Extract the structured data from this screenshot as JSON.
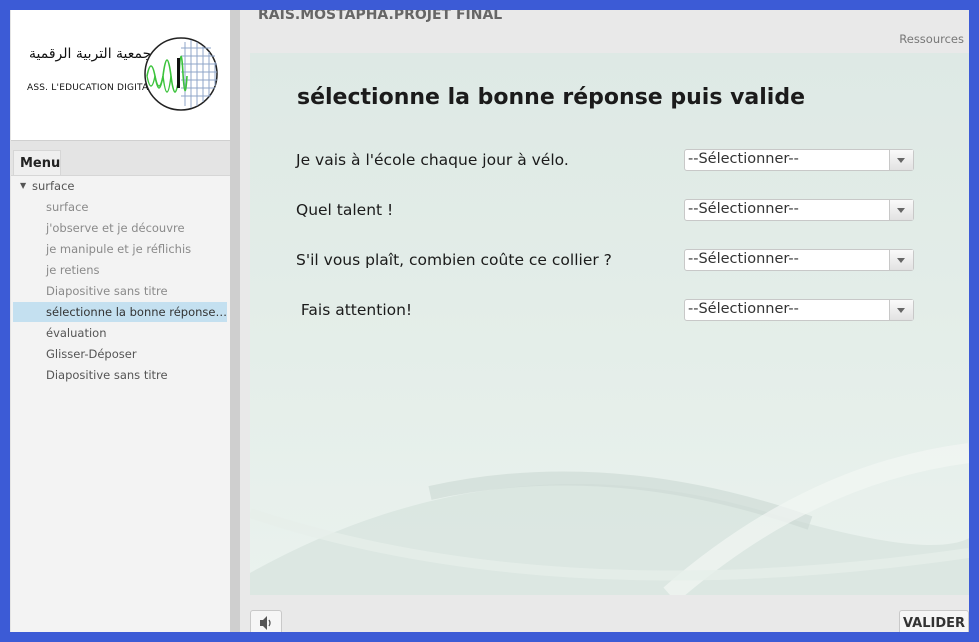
{
  "sidebar": {
    "logo": {
      "arabic_text": "جمعية التربية الرقمية",
      "latin_text": "ASS. L'EDUCATION DIGITALE"
    },
    "menu_label": "Menu",
    "section": "surface",
    "items": [
      {
        "label": "surface"
      },
      {
        "label": "j'observe et je découvre"
      },
      {
        "label": "je manipule et je réflichis"
      },
      {
        "label": "je retiens"
      },
      {
        "label": "Diapositive sans titre"
      },
      {
        "label": "sélectionne la bonne réponse p..."
      },
      {
        "label": "évaluation"
      },
      {
        "label": "Glisser-Déposer"
      },
      {
        "label": "Diapositive sans titre"
      }
    ]
  },
  "header": {
    "project_title": "RAIS.MOSTAPHA.PROJET FINAL",
    "resources_link": "Ressources"
  },
  "slide": {
    "title": "sélectionne la bonne réponse puis valide",
    "questions": [
      {
        "text": "Je vais à l'école chaque jour à vélo.",
        "selected": "--Sélectionner--"
      },
      {
        "text": "Quel talent !",
        "selected": "--Sélectionner--"
      },
      {
        "text": "S'il vous plaît, combien coûte ce collier ?",
        "selected": "--Sélectionner--"
      },
      {
        "text": " Fais attention!",
        "selected": "--Sélectionner--"
      }
    ]
  },
  "footer": {
    "audio_icon": "speaker-icon",
    "submit_label": "VALIDER"
  },
  "colors": {
    "outer_border": "#3c5bd6",
    "selected_item": "#c4e0f0"
  }
}
